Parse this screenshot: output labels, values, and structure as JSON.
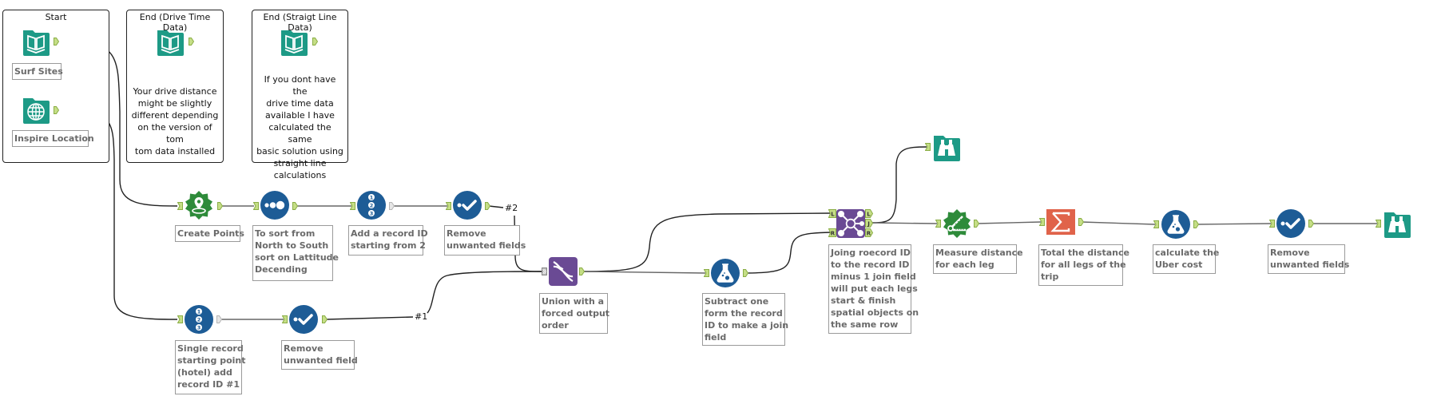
{
  "canvas": {
    "app": "Alteryx Designer workflow canvas"
  },
  "containers": [
    {
      "title": "Start"
    },
    {
      "title": "End (Drive Time Data)",
      "note": "Your drive distance might be slightly different depending on the version of tom tom data installed",
      "note_lines": [
        "Your drive distance",
        "might be slightly",
        "different depending",
        "on the version of tom",
        "tom data installed"
      ]
    },
    {
      "title": "End (Straigt Line Data)",
      "note_lines": [
        "If you dont have the",
        "drive time data",
        "available I have",
        "calculated the same",
        "basic solution using",
        "straight line",
        "calculations"
      ]
    }
  ],
  "tools": {
    "surf_sites": {
      "icon": "book-input-icon",
      "label": "Surf Sites"
    },
    "inspire_location": {
      "icon": "globe-input-icon",
      "label": "Inspire Location"
    },
    "drive_end_input": {
      "icon": "book-input-icon"
    },
    "straight_end_input": {
      "icon": "book-input-icon"
    },
    "create_points": {
      "icon": "map-pin-icon",
      "label_lines": [
        "Create Points"
      ]
    },
    "sort": {
      "icon": "sort-icon",
      "label_lines": [
        "To sort from",
        "North to South",
        "sort on Lattitude",
        "Decending"
      ]
    },
    "record_id_top": {
      "icon": "record-id-icon",
      "label_lines": [
        "Add a record ID",
        "starting from 2"
      ]
    },
    "select_top": {
      "icon": "select-check-icon",
      "label_lines": [
        "Remove",
        "unwanted fields"
      ]
    },
    "record_id_bottom": {
      "icon": "record-id-icon",
      "label_lines": [
        "Single record",
        "starting point",
        "(hotel) add",
        "record ID #1"
      ]
    },
    "select_bottom": {
      "icon": "select-check-icon",
      "label_lines": [
        "Remove",
        "unwanted field"
      ]
    },
    "union": {
      "icon": "union-dna-icon",
      "label_lines": [
        "Union with a",
        "forced output",
        "order"
      ]
    },
    "formula_join_field": {
      "icon": "formula-flask-icon",
      "label_lines": [
        "Subtract one",
        "form the record",
        "ID to make a join",
        "field"
      ]
    },
    "join": {
      "icon": "join-icon",
      "label_lines": [
        "Joing roecord ID",
        "to the record ID",
        "minus 1 join field",
        "will put each legs",
        "start & finish",
        "spatial objects on",
        "the same row"
      ],
      "inputs": [
        "L",
        "R"
      ],
      "outputs": [
        "L",
        "J",
        "R"
      ]
    },
    "browse_top": {
      "icon": "binoculars-browse-icon"
    },
    "distance": {
      "icon": "distance-ruler-icon",
      "label_lines": [
        "Measure distance",
        "for each leg"
      ]
    },
    "summarize": {
      "icon": "sigma-summarize-icon",
      "label_lines": [
        "Total the distance",
        "for all legs of the",
        "trip"
      ]
    },
    "formula_uber": {
      "icon": "formula-flask-icon",
      "label_lines": [
        "calculate the",
        "Uber cost"
      ]
    },
    "select_final": {
      "icon": "select-check-icon",
      "label_lines": [
        "Remove",
        "unwanted fields"
      ]
    },
    "browse_final": {
      "icon": "binoculars-browse-icon"
    }
  },
  "wire_labels": {
    "w2": "#2",
    "w1": "#1"
  },
  "colors": {
    "input_teal": "#1d9a86",
    "spatial_green": "#2e8b3a",
    "prep_blue": "#1d5c96",
    "join_purple": "#6a4a94",
    "summarize_orange": "#e0634a",
    "anchor_fill": "#c5de86",
    "anchor_stroke": "#8aad45"
  }
}
